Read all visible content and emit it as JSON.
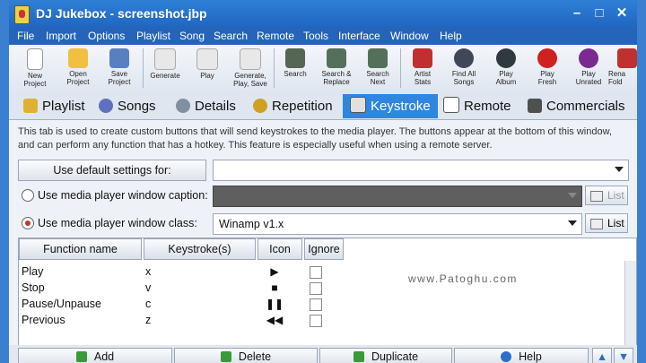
{
  "window": {
    "title": "DJ Jukebox - screenshot.jbp",
    "min_glyph": "–",
    "max_glyph": "□",
    "close_glyph": "✕"
  },
  "menu": [
    "File",
    "Import",
    "Options",
    "Playlist",
    "Song",
    "Search",
    "Remote",
    "Tools",
    "Interface",
    "Window",
    "Help"
  ],
  "toolbar": [
    {
      "line1": "New",
      "line2": "Project",
      "icon": "new-project-icon",
      "color": "#ffffff"
    },
    {
      "line1": "Open",
      "line2": "Project",
      "icon": "open-project-icon",
      "color": "#f0c040"
    },
    {
      "line1": "Save",
      "line2": "Project",
      "icon": "save-project-icon",
      "color": "#5a7fc0"
    },
    {
      "line1": "Generate",
      "line2": "",
      "icon": "generate-icon",
      "color": "#e8e8e8"
    },
    {
      "line1": "Play",
      "line2": "",
      "icon": "play-icon",
      "color": "#e8e8e8"
    },
    {
      "line1": "Generate,",
      "line2": "Play, Save",
      "icon": "generate-play-save-icon",
      "color": "#e8e8e8"
    },
    {
      "line1": "Search",
      "line2": "",
      "icon": "binoculars-icon",
      "color": "#556655"
    },
    {
      "line1": "Search &",
      "line2": "Replace",
      "icon": "search-replace-icon",
      "color": "#55705a"
    },
    {
      "line1": "Search",
      "line2": "Next",
      "icon": "search-next-icon",
      "color": "#55705a"
    },
    {
      "line1": "Artist",
      "line2": "Stats",
      "icon": "artist-stats-icon",
      "color": "#c03030"
    },
    {
      "line1": "Find All",
      "line2": "Songs",
      "icon": "find-songs-icon",
      "color": "#404858"
    },
    {
      "line1": "Play",
      "line2": "Album",
      "icon": "play-album-icon",
      "color": "#303840"
    },
    {
      "line1": "Play",
      "line2": "Fresh",
      "icon": "apple-icon",
      "color": "#d02020"
    },
    {
      "line1": "Play",
      "line2": "Unrated",
      "icon": "play-unrated-icon",
      "color": "#7a2a90"
    },
    {
      "line1": "Rena",
      "line2": "Fold",
      "icon": "rename-folder-icon",
      "color": "#c03030"
    }
  ],
  "tabs": [
    {
      "label": "Playlist",
      "icon": "playlist-icon",
      "color": "#e0b030"
    },
    {
      "label": "Songs",
      "icon": "songs-icon",
      "color": "#6070c0"
    },
    {
      "label": "Details",
      "icon": "details-gear-icon",
      "color": "#8090a0"
    },
    {
      "label": "Repetition",
      "icon": "repetition-icon",
      "color": "#d0a020"
    },
    {
      "label": "Keystroke",
      "icon": "keystroke-icon",
      "color": "#e0e0e0"
    },
    {
      "label": "Remote",
      "icon": "remote-icon",
      "color": "#ffffff"
    },
    {
      "label": "Commercials",
      "icon": "commercials-icon",
      "color": "#505050"
    }
  ],
  "description": "This tab is used to create custom buttons that will send keystrokes to the media player.  The buttons appear at the bottom of this window, and can perform any function that has a hotkey.  This feature is especially useful when using a remote server.",
  "defaults_button": "Use default settings for:",
  "defaults_value": "",
  "caption_option": {
    "label": "Use media player window caption:",
    "value": "",
    "list": "List",
    "selected": false
  },
  "class_option": {
    "label": "Use media player window class:",
    "value": "Winamp v1.x",
    "list": "List",
    "selected": true
  },
  "grid": {
    "headers": [
      "Function name",
      "Keystroke(s)",
      "Icon",
      "Ignore"
    ],
    "rows": [
      {
        "name": "Play",
        "key": "x",
        "icon": "▶"
      },
      {
        "name": "Stop",
        "key": "v",
        "icon": "■"
      },
      {
        "name": "Pause/Unpause",
        "key": "c",
        "icon": "❚❚"
      },
      {
        "name": "Previous",
        "key": "z",
        "icon": "◀◀"
      }
    ]
  },
  "buttons": {
    "add": "Add",
    "delete": "Delete",
    "duplicate": "Duplicate",
    "help": "Help"
  },
  "watermark": "www.Patoghu.com"
}
